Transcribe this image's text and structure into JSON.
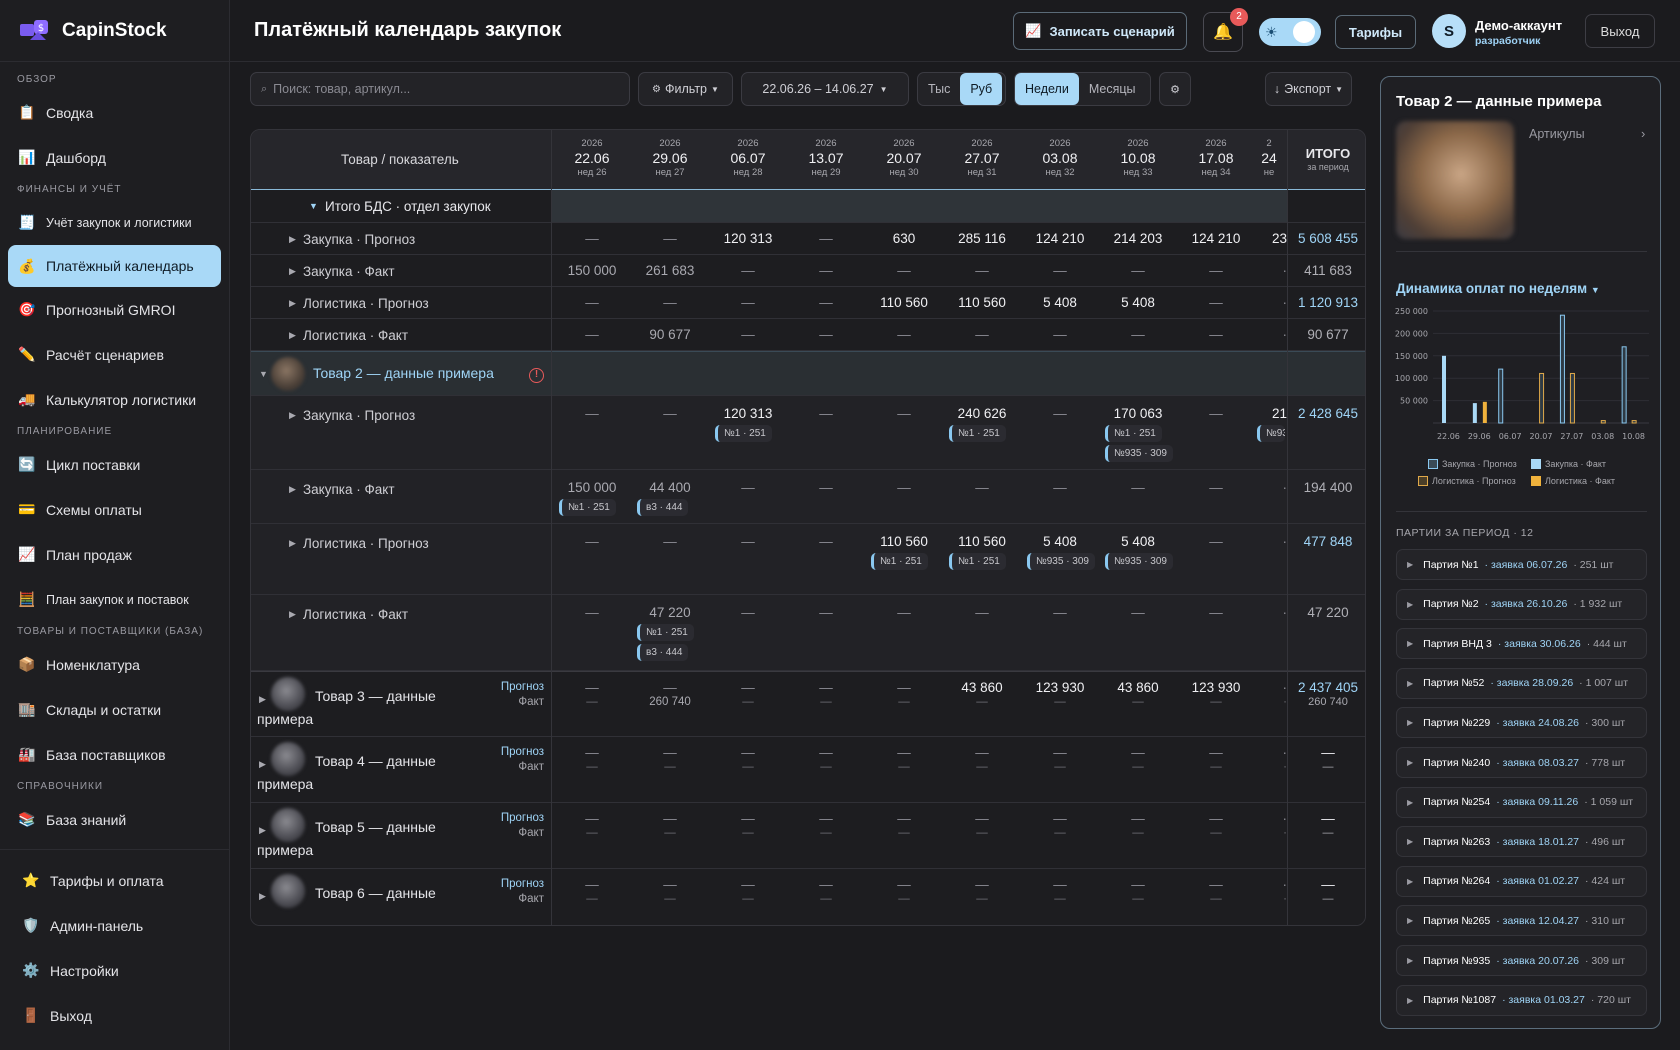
{
  "app": {
    "name": "CapinStock"
  },
  "sidebar": {
    "sections": {
      "overview": "ОБЗОР",
      "finance": "ФИНАНСЫ И УЧЁТ",
      "planning": "ПЛАНИРОВАНИЕ",
      "goods": "ТОВАРЫ И ПОСТАВЩИКИ (БАЗА)",
      "refs": "СПРАВОЧНИКИ"
    },
    "items": {
      "summary": "Сводка",
      "dashboard": "Дашборд",
      "purchases": "Учёт закупок и логистики",
      "payment_calendar": "Платёжный календарь",
      "gmroi": "Прогнозный GMROI",
      "scenarios": "Расчёт сценариев",
      "logistics_calc": "Калькулятор логистики",
      "supply_cycle": "Цикл поставки",
      "payment_schemes": "Схемы оплаты",
      "sales_plan": "План продаж",
      "purchase_plan": "План закупок и поставок",
      "nomenclature": "Номенклатура",
      "warehouses": "Склады и остатки",
      "suppliers": "База поставщиков",
      "knowledge": "База знаний"
    },
    "bottom": {
      "tariffs": "Тарифы и оплата",
      "admin": "Админ-панель",
      "settings": "Настройки",
      "logout": "Выход"
    }
  },
  "header": {
    "title": "Платёжный календарь закупок",
    "record_btn": "Записать сценарий",
    "notifications": "2",
    "tariffs_btn": "Тарифы",
    "avatar_letter": "S",
    "user_name": "Демо-аккаунт",
    "user_role": "разработчик",
    "logout_btn": "Выход"
  },
  "toolbar": {
    "search_placeholder": "Поиск: товар, артикул...",
    "filter": "Фильтр",
    "date_range": "22.06.26 – 14.06.27",
    "unit_thousand": "Тыс",
    "unit_rub": "Руб",
    "period_weeks": "Недели",
    "period_months": "Месяцы",
    "export": "Экспорт"
  },
  "table": {
    "header_label": "Товар / показатель",
    "total_label": "ИТОГО",
    "total_sub": "за период",
    "columns": [
      {
        "year": "2026",
        "date": "22.06",
        "week": "нед 26"
      },
      {
        "year": "2026",
        "date": "29.06",
        "week": "нед 27"
      },
      {
        "year": "2026",
        "date": "06.07",
        "week": "нед 28"
      },
      {
        "year": "2026",
        "date": "13.07",
        "week": "нед 29"
      },
      {
        "year": "2026",
        "date": "20.07",
        "week": "нед 30"
      },
      {
        "year": "2026",
        "date": "27.07",
        "week": "нед 31"
      },
      {
        "year": "2026",
        "date": "03.08",
        "week": "нед 32"
      },
      {
        "year": "2026",
        "date": "10.08",
        "week": "нед 33"
      },
      {
        "year": "2026",
        "date": "17.08",
        "week": "нед 34"
      },
      {
        "year": "2",
        "date": "24",
        "week": "не"
      }
    ],
    "group_total_label": "Итого БДС · отдел закупок",
    "summary_rows": [
      {
        "label": "Закупка · Прогноз",
        "values": [
          "—",
          "—",
          "120 313",
          "—",
          "630",
          "285 116",
          "124 210",
          "214 203",
          "124 210",
          "23"
        ],
        "total": "5 608 455"
      },
      {
        "label": "Закупка · Факт",
        "values": [
          "150 000",
          "261 683",
          "—",
          "—",
          "—",
          "—",
          "—",
          "—",
          "—",
          "·"
        ],
        "total": "411 683"
      },
      {
        "label": "Логистика · Прогноз",
        "values": [
          "—",
          "—",
          "—",
          "—",
          "110 560",
          "110 560",
          "5 408",
          "5 408",
          "—",
          "·"
        ],
        "total": "1 120 913"
      },
      {
        "label": "Логистика · Факт",
        "values": [
          "—",
          "90 677",
          "—",
          "—",
          "—",
          "—",
          "—",
          "—",
          "—",
          "·"
        ],
        "total": "90 677"
      }
    ],
    "product2": {
      "name": "Товар 2 — данные примера",
      "alert": "!",
      "rows": [
        {
          "label": "Закупка · Прогноз",
          "values": [
            "—",
            "—",
            "120 313",
            "—",
            "—",
            "240 626",
            "—",
            "170 063",
            "—",
            "21"
          ],
          "total": "2 428 645",
          "chips": [
            [
              "",
              "",
              "№1 · 251",
              "",
              "",
              "№1 · 251",
              "",
              "№1 · 251",
              "",
              "№93"
            ],
            [
              "",
              "",
              "",
              "",
              "",
              "",
              "",
              "№935 · 309",
              "",
              ""
            ]
          ]
        },
        {
          "label": "Закупка · Факт",
          "values": [
            "150 000",
            "44 400",
            "—",
            "—",
            "—",
            "—",
            "—",
            "—",
            "—",
            "·"
          ],
          "total": "194 400",
          "chips": [
            [
              "№1 · 251",
              "в3 · 444",
              "",
              "",
              "",
              "",
              "",
              "",
              "",
              ""
            ]
          ]
        },
        {
          "label": "Логистика · Прогноз",
          "values": [
            "—",
            "—",
            "—",
            "—",
            "110 560",
            "110 560",
            "5 408",
            "5 408",
            "—",
            "·"
          ],
          "total": "477 848",
          "chips": [
            [
              "",
              "",
              "",
              "",
              "№1 · 251",
              "№1 · 251",
              "№935 · 309",
              "№935 · 309",
              "",
              ""
            ]
          ]
        },
        {
          "label": "Логистика · Факт",
          "values": [
            "—",
            "47 220",
            "—",
            "—",
            "—",
            "—",
            "—",
            "—",
            "—",
            "·"
          ],
          "total": "47 220",
          "chips": [
            [
              "",
              "№1 · 251",
              "",
              "",
              "",
              "",
              "",
              "",
              "",
              ""
            ],
            [
              "",
              "в3 · 444",
              "",
              "",
              "",
              "",
              "",
              "",
              "",
              ""
            ]
          ]
        }
      ]
    },
    "forecast_label": "Прогноз",
    "fact_label": "Факт",
    "products": [
      {
        "name1": "Товар 3 — данные",
        "name2": "примера",
        "forecast": [
          "—",
          "—",
          "—",
          "—",
          "—",
          "43 860",
          "123 930",
          "43 860",
          "123 930",
          "·"
        ],
        "fact": [
          "—",
          "260 740",
          "—",
          "—",
          "—",
          "—",
          "—",
          "—",
          "—",
          "·"
        ],
        "total": "2 437 405",
        "total_fact": "260 740"
      },
      {
        "name1": "Товар 4 — данные",
        "name2": "примера",
        "forecast": [
          "—",
          "—",
          "—",
          "—",
          "—",
          "—",
          "—",
          "—",
          "—",
          "·"
        ],
        "fact": [
          "—",
          "—",
          "—",
          "—",
          "—",
          "—",
          "—",
          "—",
          "—",
          "·"
        ],
        "total": "—",
        "total_fact": "—"
      },
      {
        "name1": "Товар 5 — данные",
        "name2": "примера",
        "forecast": [
          "—",
          "—",
          "—",
          "—",
          "—",
          "—",
          "—",
          "—",
          "—",
          "·"
        ],
        "fact": [
          "—",
          "—",
          "—",
          "—",
          "—",
          "—",
          "—",
          "—",
          "—",
          "·"
        ],
        "total": "—",
        "total_fact": "—"
      },
      {
        "name1": "Товар 6 — данные",
        "name2": "",
        "forecast": [
          "—",
          "—",
          "—",
          "—",
          "—",
          "—",
          "—",
          "—",
          "—",
          "·"
        ],
        "fact": [
          "—",
          "—",
          "—",
          "—",
          "—",
          "—",
          "—",
          "—",
          "—",
          "·"
        ],
        "total": "—",
        "total_fact": "—"
      }
    ]
  },
  "panel": {
    "title": "Товар 2 — данные примера",
    "articles": "Артикулы",
    "chart_title": "Динамика оплат по неделям",
    "parties_header": "ПАРТИИ ЗА ПЕРИОД · 12",
    "parties": [
      {
        "name": "Партия №1",
        "date": "· заявка 06.07.26",
        "qty": "· 251 шт"
      },
      {
        "name": "Партия №2",
        "date": "· заявка 26.10.26",
        "qty": "· 1 932 шт"
      },
      {
        "name": "Партия ВНД 3",
        "date": "· заявка 30.06.26",
        "qty": "· 444 шт"
      },
      {
        "name": "Партия №52",
        "date": "· заявка 28.09.26",
        "qty": "· 1 007 шт"
      },
      {
        "name": "Партия №229",
        "date": "· заявка 24.08.26",
        "qty": "· 300 шт"
      },
      {
        "name": "Партия №240",
        "date": "· заявка 08.03.27",
        "qty": "· 778 шт"
      },
      {
        "name": "Партия №254",
        "date": "· заявка 09.11.26",
        "qty": "· 1 059 шт"
      },
      {
        "name": "Партия №263",
        "date": "· заявка 18.01.27",
        "qty": "· 496 шт"
      },
      {
        "name": "Партия №264",
        "date": "· заявка 01.02.27",
        "qty": "· 424 шт"
      },
      {
        "name": "Партия №265",
        "date": "· заявка 12.04.27",
        "qty": "· 310 шт"
      },
      {
        "name": "Партия №935",
        "date": "· заявка 20.07.26",
        "qty": "· 309 шт"
      },
      {
        "name": "Партия №1087",
        "date": "· заявка 01.03.27",
        "qty": "· 720 шт"
      }
    ]
  },
  "chart_data": {
    "type": "bar",
    "categories": [
      "22.06",
      "29.06",
      "06.07",
      "20.07",
      "27.07",
      "03.08",
      "10.08"
    ],
    "ylim": [
      0,
      250000
    ],
    "yticks": [
      "250 000",
      "200 000",
      "150 000",
      "100 000",
      "50 000"
    ],
    "series": [
      {
        "name": "Закупка · Прогноз",
        "color": "#8ac8f0",
        "style": "outline",
        "values": [
          0,
          0,
          120313,
          0,
          240626,
          0,
          170063
        ]
      },
      {
        "name": "Закупка · Факт",
        "color": "#a9d9f7",
        "style": "filled",
        "values": [
          150000,
          44400,
          0,
          0,
          0,
          0,
          0
        ]
      },
      {
        "name": "Логистика · Прогноз",
        "color": "#e0a94a",
        "style": "outline",
        "values": [
          0,
          0,
          0,
          110560,
          110560,
          5408,
          5408
        ]
      },
      {
        "name": "Логистика · Факт",
        "color": "#f0b23c",
        "style": "filled",
        "values": [
          0,
          47220,
          0,
          0,
          0,
          0,
          0
        ]
      }
    ],
    "legend": "bottom"
  }
}
